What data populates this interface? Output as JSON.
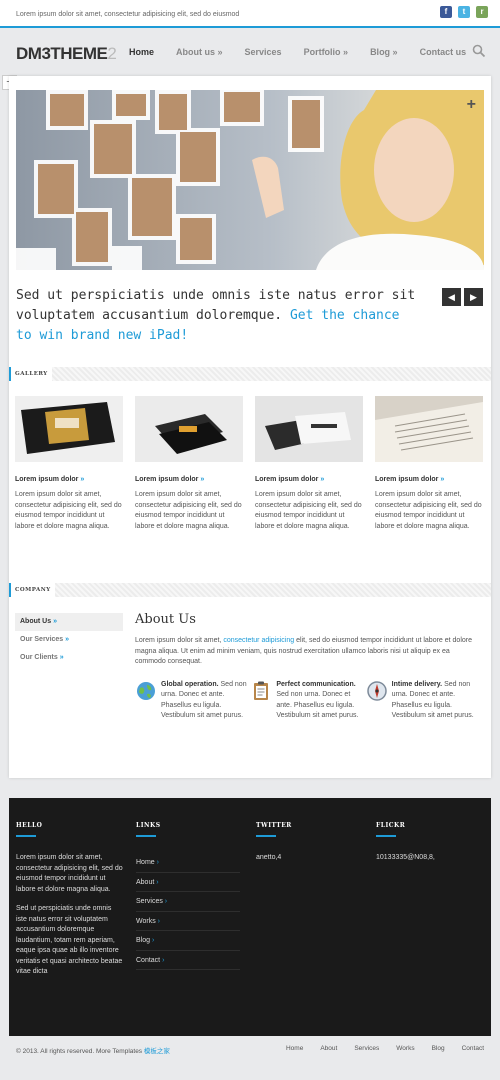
{
  "topbar": {
    "tagline": "Lorem ipsum dolor sit amet, consectetur adipisicing elit, sed do eiusmod",
    "socials": [
      "f",
      "t",
      "r"
    ]
  },
  "header": {
    "logo_main": "DM3THEME",
    "logo_num": "2",
    "nav": [
      "Home",
      "About us »",
      "Services",
      "Portfolio »",
      "Blog »",
      "Contact us"
    ]
  },
  "slider": {
    "plus": "+",
    "tagline_plain": "Sed ut perspiciatis unde omnis iste natus error sit voluptatem accusantium doloremque.",
    "tagline_accent": "Get the chance to win brand new iPad!",
    "prev": "◀",
    "next": "▶"
  },
  "gallery": {
    "heading": "GALLERY",
    "items": [
      {
        "title": "Lorem ipsum dolor",
        "arrow": "»",
        "text": "Lorem ipsum dolor sit amet, consectetur adipisicing elit, sed do eiusmod tempor incididunt ut labore et dolore magna aliqua."
      },
      {
        "title": "Lorem ipsum dolor",
        "arrow": "»",
        "text": "Lorem ipsum dolor sit amet, consectetur adipisicing elit, sed do eiusmod tempor incididunt ut labore et dolore magna aliqua."
      },
      {
        "title": "Lorem ipsum dolor",
        "arrow": "»",
        "text": "Lorem ipsum dolor sit amet, consectetur adipisicing elit, sed do eiusmod tempor incididunt ut labore et dolore magna aliqua."
      },
      {
        "title": "Lorem ipsum dolor",
        "arrow": "»",
        "text": "Lorem ipsum dolor sit amet, consectetur adipisicing elit, sed do eiusmod tempor incididunt ut labore et dolore magna aliqua."
      }
    ]
  },
  "company": {
    "heading": "COMPANY",
    "nav": [
      "About Us",
      "Our Services",
      "Our Clients"
    ],
    "arrow": "»",
    "about_title": "About Us",
    "about_text_1": "Lorem ipsum dolor sit amet,",
    "about_link": "consectetur adipisicing",
    "about_text_2": "elit, sed do eiusmod tempor incididunt ut labore et dolore magna aliqua. Ut enim ad minim veniam, quis nostrud exercitation ullamco laboris nisi ut aliquip ex ea commodo consequat.",
    "features": [
      {
        "title": "Global operation.",
        "text": "Sed non urna. Donec et ante. Phasellus eu ligula. Vestibulum sit amet purus."
      },
      {
        "title": "Perfect communication.",
        "text": "Sed non urna. Donec et ante. Phasellus eu ligula. Vestibulum sit amet purus."
      },
      {
        "title": "Intime delivery.",
        "text": "Sed non urna. Donec et ante. Phasellus eu ligula. Vestibulum sit amet purus."
      }
    ]
  },
  "footer": {
    "hello_heading": "HELLO",
    "hello_text_1": "Lorem ipsum dolor sit amet, consectetur adipisicing elit, sed do eiusmod tempor incididunt ut labore et dolore magna aliqua.",
    "hello_text_2": "Sed ut perspiciatis unde omnis iste natus error sit voluptatem accusantium doloremque laudantium, totam rem aperiam, eaque ipsa quae ab illo inventore veritatis et quasi architecto beatae vitae dicta",
    "links_heading": "LINKS",
    "links": [
      "Home",
      "About",
      "Services",
      "Works",
      "Blog",
      "Contact"
    ],
    "link_arrow": "›",
    "twitter_heading": "TWITTER",
    "twitter_text": "anetto,4",
    "flickr_heading": "FLICKR",
    "flickr_text": "10133335@N08,8,"
  },
  "bottom": {
    "copyright": "© 2013. All rights reserved. More Templates",
    "copyright_cn": "模板之家",
    "nav": [
      "Home",
      "About",
      "Services",
      "Works",
      "Blog",
      "Contact"
    ]
  },
  "colors": {
    "accent": "#1e9bd7",
    "footer_bg": "#1a1a1a"
  }
}
